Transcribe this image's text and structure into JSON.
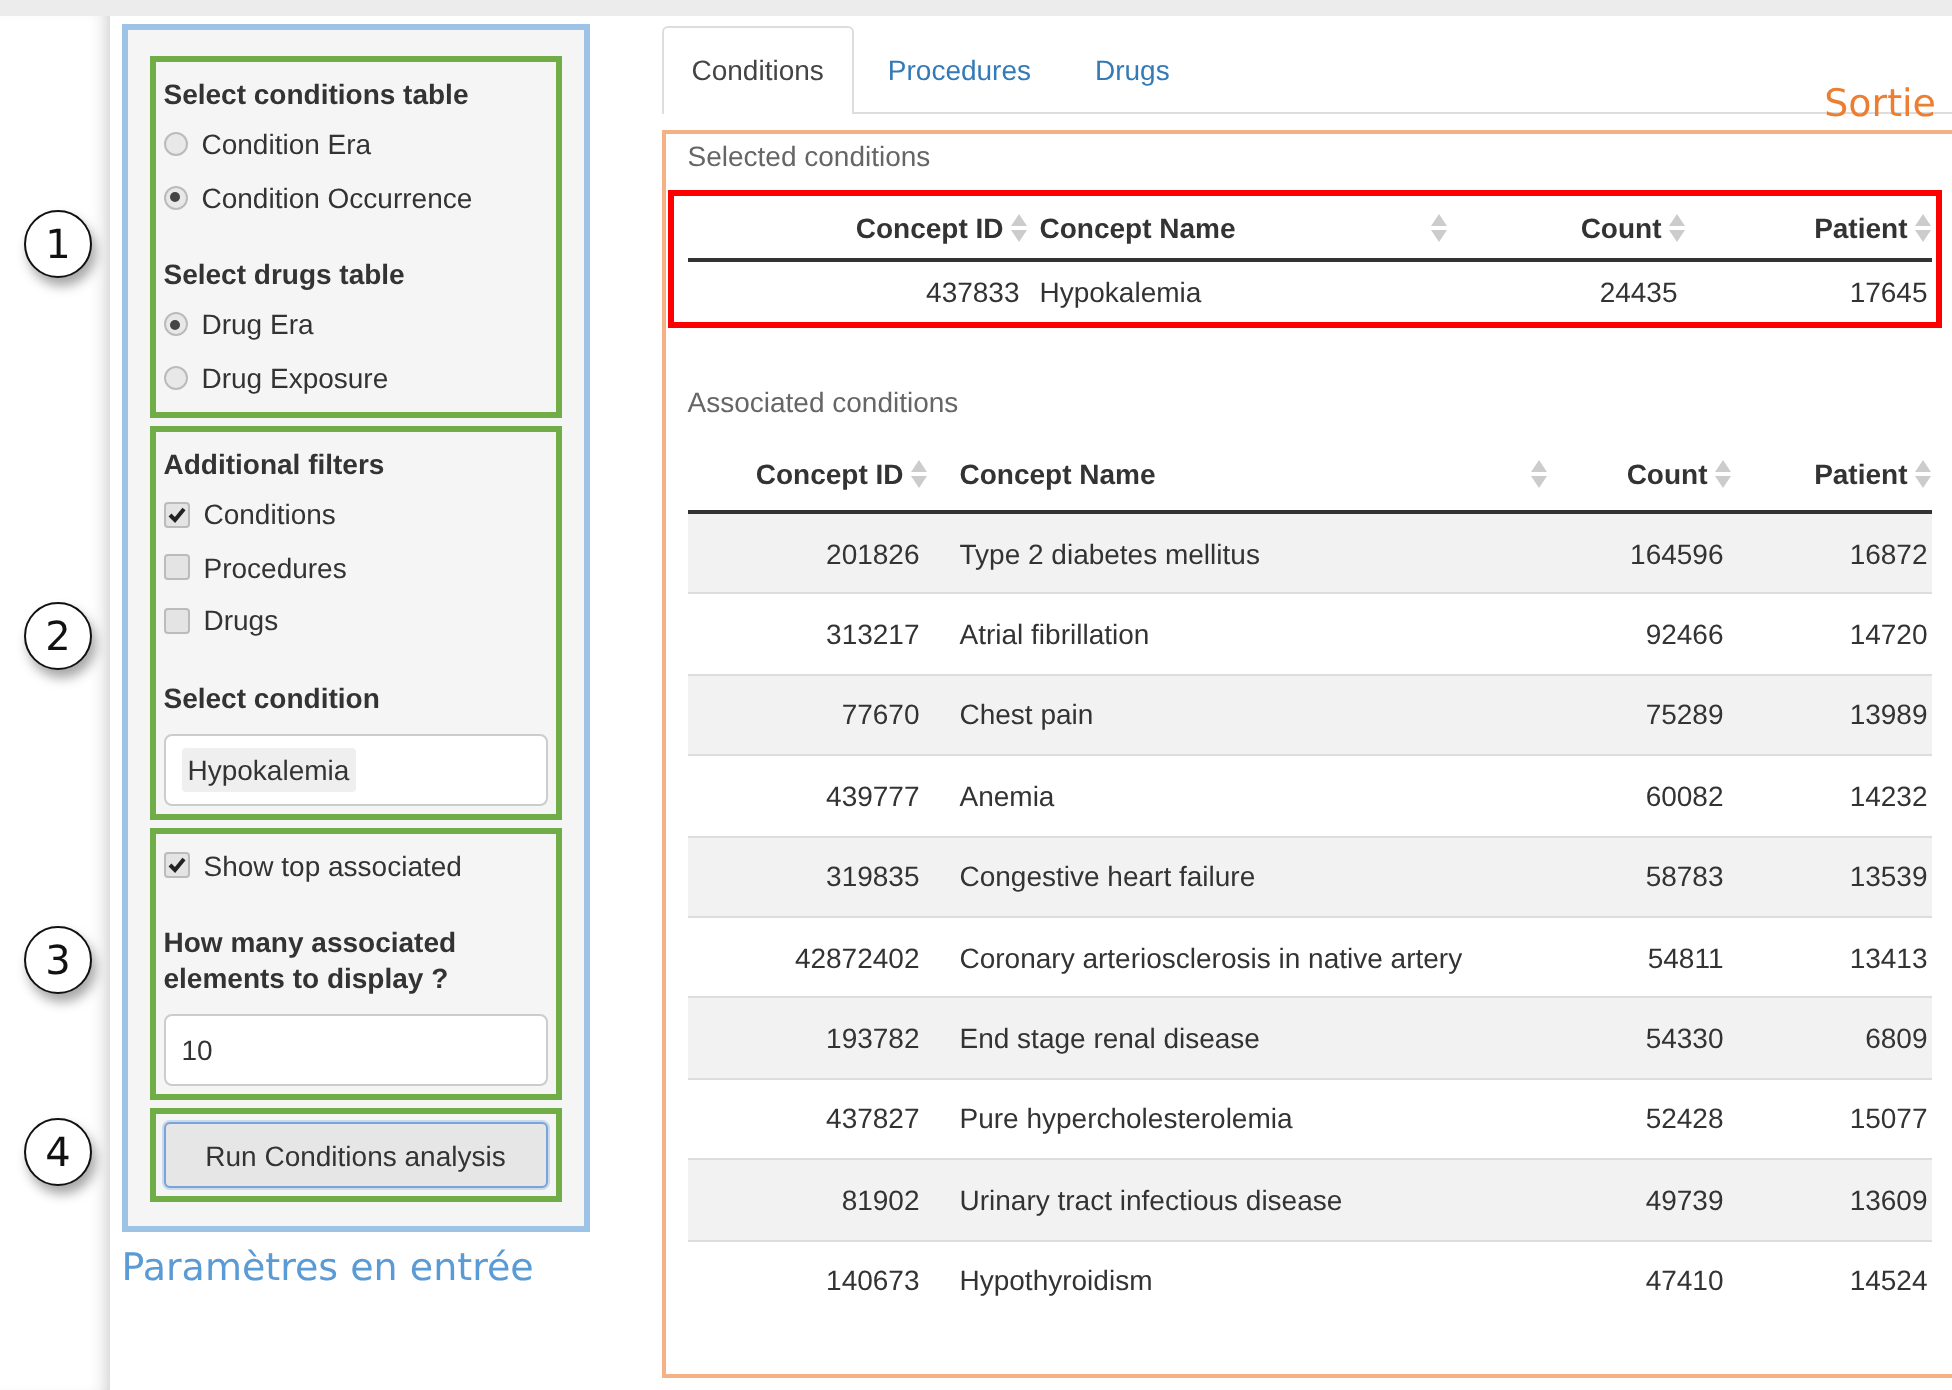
{
  "annotations": [
    {
      "label": "1"
    },
    {
      "label": "2"
    },
    {
      "label": "3"
    },
    {
      "label": "4"
    }
  ],
  "sidebar": {
    "boxes": [
      {
        "items": [
          {
            "kind": "heading",
            "label": "Select conditions table"
          },
          {
            "kind": "radio",
            "label": "Condition Era",
            "selected": false
          },
          {
            "kind": "radio",
            "label": "Condition Occurrence",
            "selected": true
          },
          {
            "kind": "heading",
            "label": "Select drugs table"
          },
          {
            "kind": "radio",
            "label": "Drug Era",
            "selected": true
          },
          {
            "kind": "radio",
            "label": "Drug Exposure",
            "selected": false
          }
        ]
      },
      {
        "items": [
          {
            "kind": "heading",
            "label": "Additional filters"
          },
          {
            "kind": "checkbox",
            "label": "Conditions",
            "checked": true
          },
          {
            "kind": "checkbox",
            "label": "Procedures",
            "checked": false
          },
          {
            "kind": "checkbox",
            "label": "Drugs",
            "checked": false
          },
          {
            "kind": "heading",
            "label": "Select condition"
          },
          {
            "kind": "tag-select",
            "value": "Hypokalemia"
          }
        ]
      },
      {
        "items": [
          {
            "kind": "checkbox",
            "label": "Show top associated",
            "checked": true
          },
          {
            "kind": "heading",
            "label": "How many associated elements to display ?"
          },
          {
            "kind": "text-input",
            "value": "10"
          }
        ]
      },
      {
        "items": [
          {
            "kind": "button",
            "label": "Run Conditions analysis"
          }
        ]
      }
    ],
    "caption": "Paramètres en entrée"
  },
  "tabs": [
    {
      "label": "Conditions",
      "selected": true
    },
    {
      "label": "Procedures",
      "selected": false
    },
    {
      "label": "Drugs",
      "selected": false
    }
  ],
  "output_caption": "Sortie",
  "tables": [
    {
      "title": "Selected conditions",
      "columns": [
        "Concept ID",
        "Concept Name",
        "Count",
        "Patient"
      ],
      "rows": [
        [
          "437833",
          "Hypokalemia",
          "24435",
          "17645"
        ]
      ]
    },
    {
      "title": "Associated conditions",
      "columns": [
        "Concept ID",
        "Concept Name",
        "Count",
        "Patient"
      ],
      "rows": [
        [
          "201826",
          "Type 2 diabetes mellitus",
          "164596",
          "16872"
        ],
        [
          "313217",
          "Atrial fibrillation",
          "92466",
          "14720"
        ],
        [
          "77670",
          "Chest pain",
          "75289",
          "13989"
        ],
        [
          "439777",
          "Anemia",
          "60082",
          "14232"
        ],
        [
          "319835",
          "Congestive heart failure",
          "58783",
          "13539"
        ],
        [
          "42872402",
          "Coronary arteriosclerosis in native artery",
          "54811",
          "13413"
        ],
        [
          "193782",
          "End stage renal disease",
          "54330",
          "6809"
        ],
        [
          "437827",
          "Pure hypercholesterolemia",
          "52428",
          "15077"
        ],
        [
          "81902",
          "Urinary tract infectious disease",
          "49739",
          "13609"
        ],
        [
          "140673",
          "Hypothyroidism",
          "47410",
          "14524"
        ]
      ]
    }
  ]
}
